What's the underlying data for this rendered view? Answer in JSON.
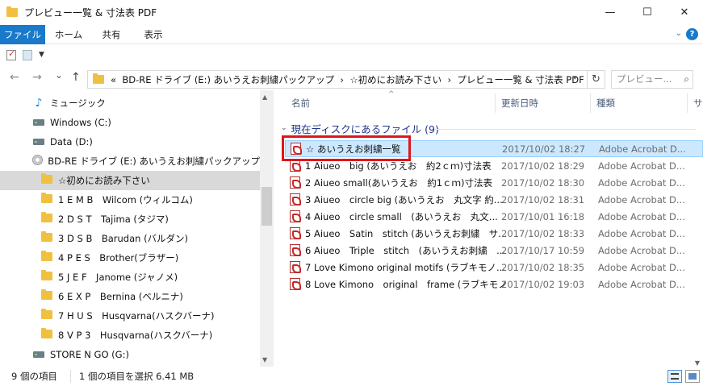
{
  "window": {
    "title": "プレビュー一覧 & 寸法表 PDF",
    "minimize": "—",
    "maximize": "☐",
    "close": "✕"
  },
  "ribbon": {
    "tabs": [
      "ファイル",
      "ホーム",
      "共有",
      "表示"
    ],
    "collapse_icon": "chevron-down-icon",
    "help": "?"
  },
  "nav": {
    "back": "←",
    "forward": "→",
    "recent": "⌄",
    "up": "↑",
    "path_prefix": "«",
    "breadcrumb": [
      "BD-RE ドライブ (E:) あいうえお刺繍パックアップ",
      "☆初めにお読み下さい",
      "プレビュー一覧 & 寸法表 PDF"
    ],
    "separator": "›",
    "search_placeholder": "プレビュー..."
  },
  "sidebar": {
    "items": [
      {
        "label": "ミュージック",
        "icon": "music-icon"
      },
      {
        "label": "Windows (C:)",
        "icon": "drive-icon"
      },
      {
        "label": "Data (D:)",
        "icon": "drive-icon"
      },
      {
        "label": "BD-RE ドライブ (E:) あいうえお刺繍パックアップ",
        "icon": "disc-icon"
      },
      {
        "label": "☆初めにお読み下さい",
        "icon": "folder-icon"
      },
      {
        "label": "1 E M B　Wilcom (ウィルコム)",
        "icon": "folder-icon"
      },
      {
        "label": "2 D S T　Tajima (タジマ)",
        "icon": "folder-icon"
      },
      {
        "label": "3 D S B　Barudan (バルダン)",
        "icon": "folder-icon"
      },
      {
        "label": "4 P E S　Brother(ブラザー)",
        "icon": "folder-icon"
      },
      {
        "label": "5 J E F　Janome (ジャノメ)",
        "icon": "folder-icon"
      },
      {
        "label": "6 E X P　Bernina (ベルニナ)",
        "icon": "folder-icon"
      },
      {
        "label": "7 H U S　Husqvarna(ハスクバーナ)",
        "icon": "folder-icon"
      },
      {
        "label": "8 V P 3　Husqvarna(ハスクバーナ)",
        "icon": "folder-icon"
      },
      {
        "label": "STORE N GO (G:)",
        "icon": "drive-icon"
      }
    ]
  },
  "filelist": {
    "columns": {
      "name": "名前",
      "date": "更新日時",
      "type": "種類",
      "size": "サ"
    },
    "group_label": "現在ディスクにあるファイル (9)",
    "files": [
      {
        "name": "☆ あいうえお刺繍一覧",
        "date": "2017/10/02 18:27",
        "type": "Adobe Acrobat D..."
      },
      {
        "name": "1 Aiueo　big (あいうえお　約2ｃｍ)寸法表",
        "date": "2017/10/02 18:29",
        "type": "Adobe Acrobat D..."
      },
      {
        "name": "2 Aiueo small(あいうえお　約1ｃｍ)寸法表",
        "date": "2017/10/02 18:30",
        "type": "Adobe Acrobat D..."
      },
      {
        "name": "3 Aiueo　circle big (あいうえお　丸文字 約...",
        "date": "2017/10/02 18:31",
        "type": "Adobe Acrobat D..."
      },
      {
        "name": "4 Aiueo　circle small　(あいうえお　丸文...",
        "date": "2017/10/01 16:18",
        "type": "Adobe Acrobat D..."
      },
      {
        "name": "5 Aiueo　Satin　stitch (あいうえお刺繍　サ...",
        "date": "2017/10/02 18:33",
        "type": "Adobe Acrobat D..."
      },
      {
        "name": "6 Aiueo　Triple　stitch　(あいうえお刺繍　...",
        "date": "2017/10/17 10:59",
        "type": "Adobe Acrobat D..."
      },
      {
        "name": "7 Love Kimono original motifs (ラブキモノ...",
        "date": "2017/10/02 18:35",
        "type": "Adobe Acrobat D..."
      },
      {
        "name": "8 Love Kimono　original　frame (ラブキモノ...",
        "date": "2017/10/02 19:03",
        "type": "Adobe Acrobat D..."
      }
    ]
  },
  "status": {
    "item_count": "9 個の項目",
    "selection": "1 個の項目を選択  6.41 MB"
  },
  "colors": {
    "accent": "#1979ca",
    "selection": "#cce8ff",
    "highlight_box": "#e0161b"
  }
}
